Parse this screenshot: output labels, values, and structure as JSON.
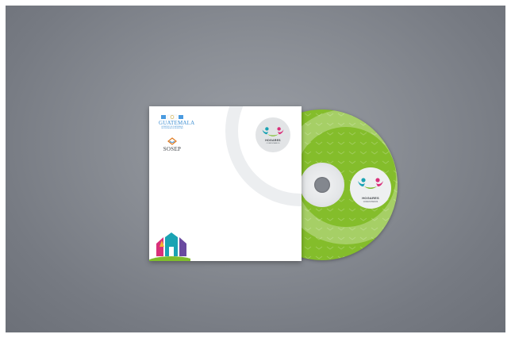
{
  "colors": {
    "backdrop": "#8b8f96",
    "disc_green": "#84bd2b",
    "gov_blue": "#3f8fd2",
    "figure_teal": "#1aa3b3",
    "figure_magenta": "#d9307a",
    "figure_green": "#7fbd2c"
  },
  "sleeve": {
    "emblem": {
      "icon": "hogares-figures-icon",
      "brand": "HOGARES",
      "tagline": "COMUNITARIOS"
    },
    "government": {
      "crest_icon": "guatemala-crest-icon",
      "name": "GUATEMALA",
      "subtitle": "GOBIERNO DE GUATEMALA / SECRETARÍA DE BIENESTAR"
    },
    "sosep": {
      "icon": "sosep-logo-icon",
      "name": "SOSEP"
    },
    "house_logo_icon": "house-family-icon"
  },
  "disc": {
    "emblem": {
      "icon": "hogares-figures-icon",
      "brand": "HOGARES",
      "tagline": "COMUNITARIOS"
    }
  }
}
